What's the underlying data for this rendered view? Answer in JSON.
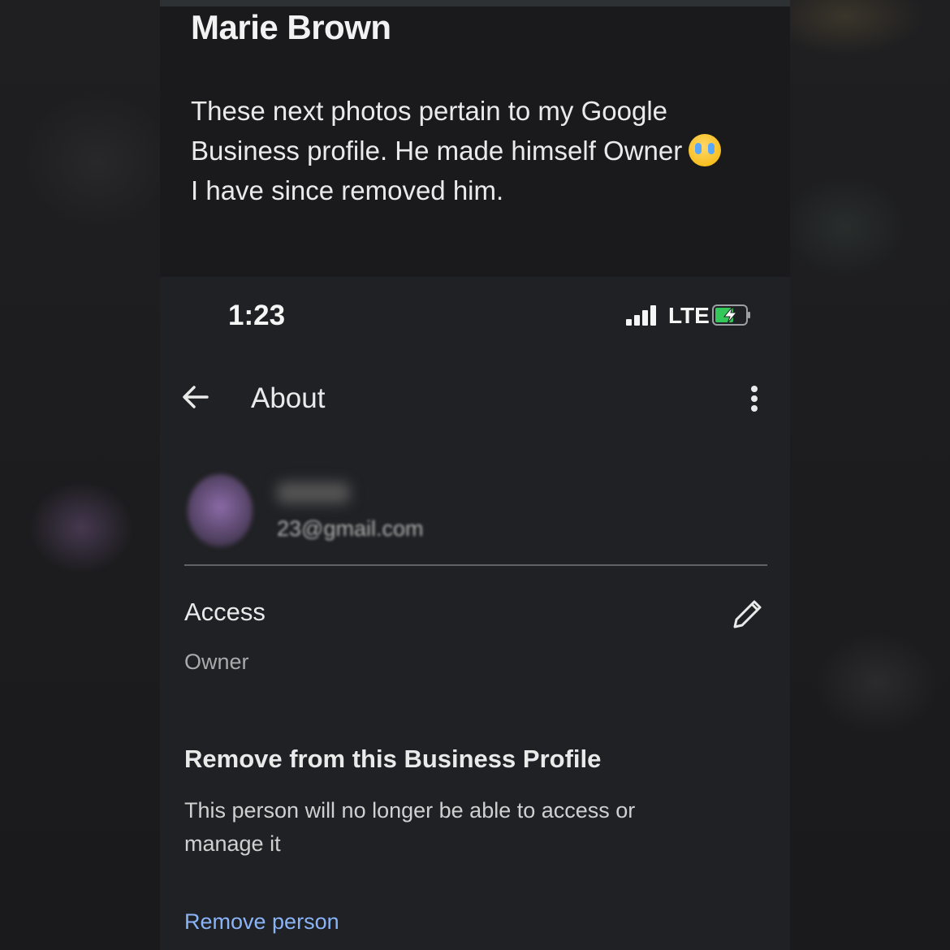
{
  "post": {
    "author": "Marie Brown",
    "text": "These next photos pertain to my Google Business profile. He made himself Owner",
    "text_line2": "I have since removed him.",
    "emoji": "loudly-crying-face"
  },
  "status_bar": {
    "time": "1:23",
    "network": "LTE",
    "signal": "full",
    "battery": "charging"
  },
  "app_bar": {
    "title": "About",
    "back_icon": "arrow-left-icon",
    "menu_icon": "more-vert-icon"
  },
  "user": {
    "email_visible": "23@gmail.com",
    "avatar_color": "#8a6aa6"
  },
  "access": {
    "label": "Access",
    "value": "Owner",
    "edit_icon": "pencil-icon"
  },
  "remove": {
    "title": "Remove from this Business Profile",
    "description": "This person will no longer be able to access or manage it",
    "action": "Remove person",
    "action_color": "#8ab4f8"
  }
}
